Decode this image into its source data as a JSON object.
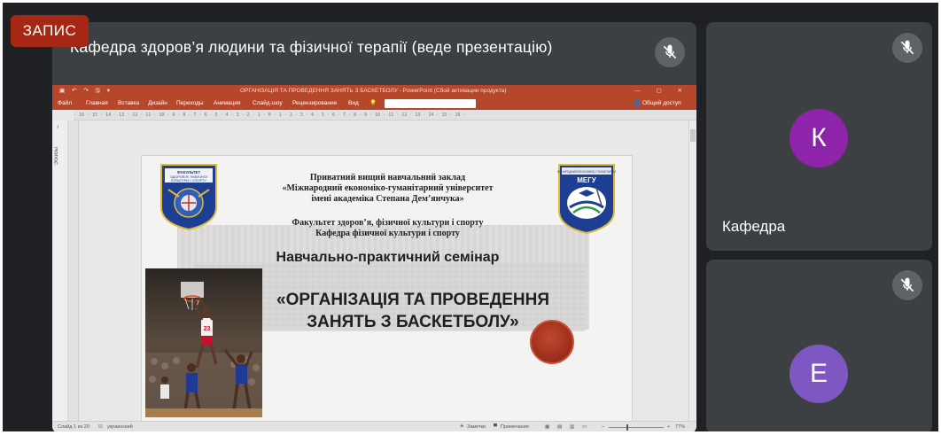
{
  "recording": {
    "label": "ЗАПИС"
  },
  "presenter": {
    "title": "Кафедра здоров’я людини та фізичної терапії (веде презентацію)",
    "mic_icon": "mic-off-icon"
  },
  "ppt": {
    "quick_access": "▣ ↶ ↷ 🖫 ▾",
    "doc_title": "ОРГАНІЗАЦІЯ ТА ПРОВЕДЕННЯ ЗАНЯТЬ З БАСКЕТБОЛУ - PowerPoint (Сбой активации продукта)",
    "window_buttons": "—  ▢  ✕",
    "ribbon_tabs": [
      "Файл",
      "Главная",
      "Вставка",
      "Дизайн",
      "Переходы",
      "Анимация",
      "Слайд-шоу",
      "Рецензирование",
      "Вид"
    ],
    "share": "Общий доступ",
    "ruler": "· 16 · 15 · 14 · 13 · 12 · 11 · 10 · 9 · 8 · 7 · 6 · 5 · 4 · 3 · 2 · 1 · 0 · 1 · 2 · 3 · 4 · 5 · 6 · 7 · 8 · 9 · 10 · 11 · 12 · 13 · 14 · 15 · 16 ·",
    "left_pane_label": "Эскизы",
    "status": {
      "slide_info": "Слайд 1 из 20",
      "language": "украинский",
      "notes": "Заметки",
      "comments": "Примечания",
      "zoom": "77%"
    }
  },
  "slide": {
    "institution_line1": "Приватний вищий навчальний заклад",
    "institution_line2": "«Міжнародний економіко-гуманітарний університет",
    "institution_line3": "імені академіка Степана Дем’янчука»",
    "faculty_line1": "Факультет здоров’я, фізичної культури і спорту",
    "faculty_line2": "Кафедра фізичної культури і спорту",
    "seminar": "Навчально-практичний семінар",
    "topic_line1": "«ОРГАНІЗАЦІЯ ТА ПРОВЕДЕННЯ",
    "topic_line2": "ЗАНЯТЬ З БАСКЕТБОЛУ»",
    "left_emblem_text": "ФАКУЛЬТЕТ ЗДОРОВ’Я, ФІЗИЧНОЇ КУЛЬТУРИ І СПОРТУ",
    "right_emblem_text": "МЕГУ"
  },
  "participants": [
    {
      "initial": "К",
      "name": "Кафедра",
      "color": "#8e24aa"
    },
    {
      "initial": "Е",
      "name": "",
      "color": "#7e57c2"
    }
  ],
  "colors": {
    "meet_bg": "#202124",
    "tile_bg": "#3c4043",
    "ppt_accent": "#b7472a",
    "rec": "#a52714"
  }
}
